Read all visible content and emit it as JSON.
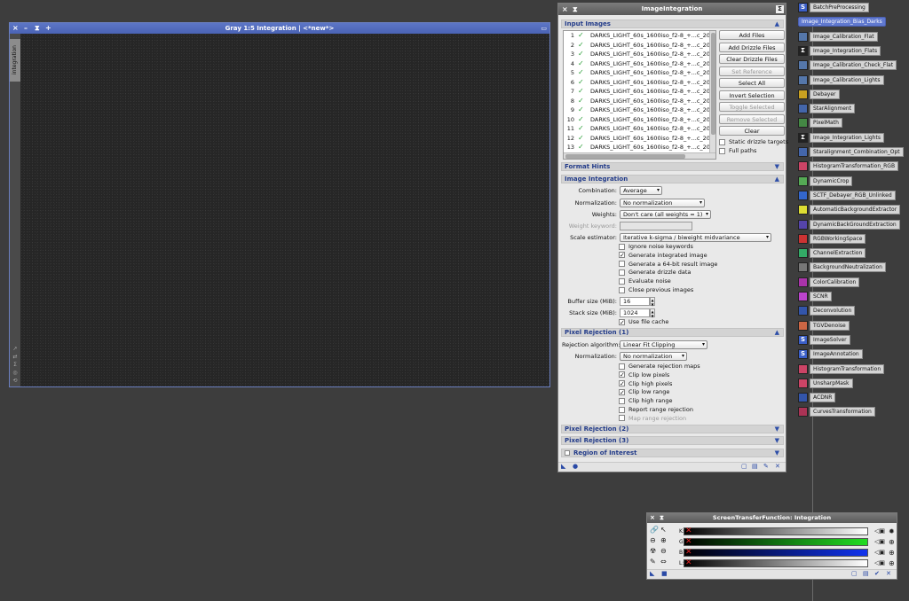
{
  "image_window": {
    "title": "Gray 1:5 Integration | <*new*>",
    "side_tab": "integration",
    "controls": [
      "×",
      "–",
      "⧗",
      "+"
    ]
  },
  "dialog": {
    "title": "ImageIntegration",
    "sections": {
      "input_images": "Input Images",
      "format_hints": "Format Hints",
      "image_integration": "Image Integration",
      "pixel_rejection_1": "Pixel Rejection (1)",
      "pixel_rejection_2": "Pixel Rejection (2)",
      "pixel_rejection_3": "Pixel Rejection (3)",
      "region_of_interest": "Region of Interest"
    },
    "files": [
      {
        "n": "1",
        "name": "DARKS_LIGHT_60s_1600iso_f2-8_+...c_2017("
      },
      {
        "n": "2",
        "name": "DARKS_LIGHT_60s_1600iso_f2-8_+...c_2017("
      },
      {
        "n": "3",
        "name": "DARKS_LIGHT_60s_1600iso_f2-8_+...c_2017("
      },
      {
        "n": "4",
        "name": "DARKS_LIGHT_60s_1600iso_f2-8_+...c_2017("
      },
      {
        "n": "5",
        "name": "DARKS_LIGHT_60s_1600iso_f2-8_+...c_2017("
      },
      {
        "n": "6",
        "name": "DARKS_LIGHT_60s_1600iso_f2-8_+...c_2017("
      },
      {
        "n": "7",
        "name": "DARKS_LIGHT_60s_1600iso_f2-8_+...c_2017("
      },
      {
        "n": "8",
        "name": "DARKS_LIGHT_60s_1600iso_f2-8_+...c_2017("
      },
      {
        "n": "9",
        "name": "DARKS_LIGHT_60s_1600iso_f2-8_+...c_2017("
      },
      {
        "n": "10",
        "name": "DARKS_LIGHT_60s_1600iso_f2-8_+...c_2017("
      },
      {
        "n": "11",
        "name": "DARKS_LIGHT_60s_1600iso_f2-8_+...c_2017("
      },
      {
        "n": "12",
        "name": "DARKS_LIGHT_60s_1600iso_f2-8_+...c_2017("
      },
      {
        "n": "13",
        "name": "DARKS_LIGHT_60s_1600iso_f2-8_+...c_2017("
      }
    ],
    "buttons": {
      "add_files": "Add Files",
      "add_drizzle": "Add Drizzle Files",
      "clear_drizzle": "Clear Drizzle Files",
      "set_reference": "Set Reference",
      "select_all": "Select All",
      "invert_selection": "Invert Selection",
      "toggle_selected": "Toggle Selected",
      "remove_selected": "Remove Selected",
      "clear": "Clear"
    },
    "static_drizzle": "Static drizzle targets",
    "full_paths": "Full paths",
    "integration": {
      "combination_label": "Combination:",
      "combination_value": "Average",
      "normalization_label": "Normalization:",
      "normalization_value": "No normalization",
      "weights_label": "Weights:",
      "weights_value": "Don't care (all weights = 1)",
      "weight_keyword_label": "Weight keyword:",
      "weight_keyword_value": "",
      "scale_label": "Scale estimator:",
      "scale_value": "Iterative k-sigma / biweight midvariance",
      "options": [
        {
          "label": "Ignore noise keywords",
          "checked": false
        },
        {
          "label": "Generate integrated image",
          "checked": true
        },
        {
          "label": "Generate a 64-bit result image",
          "checked": false
        },
        {
          "label": "Generate drizzle data",
          "checked": false
        },
        {
          "label": "Evaluate noise",
          "checked": false
        },
        {
          "label": "Close previous images",
          "checked": false
        }
      ],
      "buffer_label": "Buffer size (MiB):",
      "buffer_value": "16",
      "stack_label": "Stack size (MiB):",
      "stack_value": "1024",
      "file_cache": "Use file cache"
    },
    "rejection": {
      "algorithm_label": "Rejection algorithm:",
      "algorithm_value": "Linear Fit Clipping",
      "normalization_label": "Normalization:",
      "normalization_value": "No normalization",
      "options": [
        {
          "label": "Generate rejection maps",
          "checked": false,
          "disabled": false
        },
        {
          "label": "Clip low pixels",
          "checked": true,
          "disabled": false
        },
        {
          "label": "Clip high pixels",
          "checked": true,
          "disabled": false
        },
        {
          "label": "Clip low range",
          "checked": true,
          "disabled": false
        },
        {
          "label": "Clip high range",
          "checked": false,
          "disabled": false
        },
        {
          "label": "Report range rejection",
          "checked": false,
          "disabled": false
        },
        {
          "label": "Map range rejection",
          "checked": false,
          "disabled": true
        }
      ]
    }
  },
  "process_icons": [
    {
      "label": "BatchPreProcessing",
      "glyph": "S",
      "color": "#3b5fc8",
      "selected": false
    },
    {
      "label": "Image_Integration_Bias_Darks",
      "glyph": "Σ",
      "color": "#222222",
      "selected": true
    },
    {
      "label": "Image_Calibration_Flat",
      "glyph": "",
      "color": "#5577aa",
      "selected": false
    },
    {
      "label": "Image_Integration_Flats",
      "glyph": "Σ",
      "color": "#222222",
      "selected": false
    },
    {
      "label": "Image_Calibration_Check_Flat",
      "glyph": "",
      "color": "#5577aa",
      "selected": false
    },
    {
      "label": "Image_Calibration_Lights",
      "glyph": "",
      "color": "#5577aa",
      "selected": false
    },
    {
      "label": "Debayer",
      "glyph": "",
      "color": "#c8a020",
      "selected": false
    },
    {
      "label": "StarAlignment",
      "glyph": "",
      "color": "#4466aa",
      "selected": false
    },
    {
      "label": "PixelMath",
      "glyph": "",
      "color": "#448844",
      "selected": false
    },
    {
      "label": "Image_Integration_Lights",
      "glyph": "Σ",
      "color": "#222222",
      "selected": false
    },
    {
      "label": "Staralignment_Combination_Opt",
      "glyph": "",
      "color": "#4466aa",
      "selected": false
    },
    {
      "label": "HistogramTransformation_RGB",
      "glyph": "",
      "color": "#cc4466",
      "selected": false
    },
    {
      "label": "DynamicCrop",
      "glyph": "",
      "color": "#55aa55",
      "selected": false
    },
    {
      "label": "SCTF_Debayer_RGB_Unlinked",
      "glyph": "",
      "color": "#3366cc",
      "selected": false
    },
    {
      "label": "AutomaticBackgroundExtractor",
      "glyph": "",
      "color": "#dddd33",
      "selected": false
    },
    {
      "label": "DynamicBackGroundExtraction",
      "glyph": "",
      "color": "#5544aa",
      "selected": false
    },
    {
      "label": "RGBWorkingSpace",
      "glyph": "",
      "color": "#cc3333",
      "selected": false
    },
    {
      "label": "ChannelExtraction",
      "glyph": "",
      "color": "#33aa66",
      "selected": false
    },
    {
      "label": "BackgroundNeutralization",
      "glyph": "",
      "color": "#777777",
      "selected": false
    },
    {
      "label": "ColorCalibration",
      "glyph": "",
      "color": "#aa33aa",
      "selected": false
    },
    {
      "label": "SCNR",
      "glyph": "",
      "color": "#bb44cc",
      "selected": false
    },
    {
      "label": "Deconvolution",
      "glyph": "",
      "color": "#3355aa",
      "selected": false
    },
    {
      "label": "TGVDenoise",
      "glyph": "",
      "color": "#cc6644",
      "selected": false
    },
    {
      "label": "ImageSolver",
      "glyph": "S",
      "color": "#3b5fc8",
      "selected": false
    },
    {
      "label": "ImageAnnotation",
      "glyph": "S",
      "color": "#3b5fc8",
      "selected": false
    },
    {
      "label": "HistogramTransformation",
      "glyph": "",
      "color": "#cc4466",
      "selected": false
    },
    {
      "label": "UnsharpMask",
      "glyph": "",
      "color": "#cc4466",
      "selected": false
    },
    {
      "label": "ACDNR",
      "glyph": "",
      "color": "#3355aa",
      "selected": false
    },
    {
      "label": "CurvesTransformation",
      "glyph": "",
      "color": "#aa3355",
      "selected": false
    }
  ],
  "stf": {
    "title": "ScreenTransferFunction: Integration",
    "channels": [
      {
        "label": "K:",
        "color": "#ffffff"
      },
      {
        "label": "G:",
        "color": "#22dd22"
      },
      {
        "label": "B:",
        "color": "#1133ee"
      },
      {
        "label": "L:",
        "color": "#ffffff"
      }
    ]
  }
}
